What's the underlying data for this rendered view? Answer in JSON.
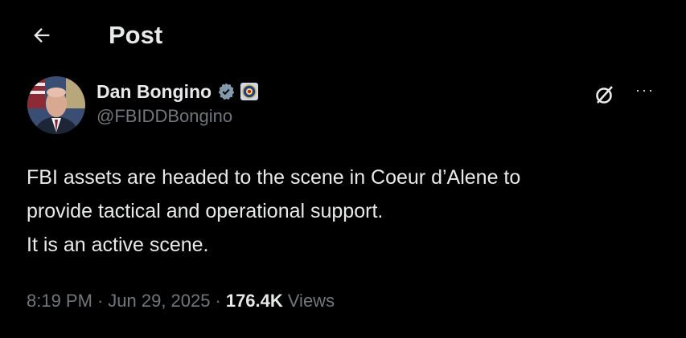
{
  "header": {
    "back_icon": "arrow-left-icon",
    "title": "Post"
  },
  "author": {
    "display_name": "Dan Bongino",
    "handle": "@FBIDDBongino",
    "verified_icon": "verified-badge-icon",
    "affiliation_icon": "fbi-seal-icon",
    "verified_color": "#829aab"
  },
  "actions": {
    "grok_icon": "grok-icon",
    "more_label": "···"
  },
  "tweet": {
    "lines": [
      "FBI assets are headed to the scene in Coeur d’Alene to",
      "provide tactical and operational support.",
      "It is an active scene."
    ]
  },
  "meta": {
    "time": "8:19 PM",
    "sep1": "·",
    "date": "Jun 29, 2025",
    "sep2": "·",
    "views_count": "176.4K",
    "views_label": "Views"
  },
  "colors": {
    "background": "#000000",
    "text_primary": "#e7e9ea",
    "text_secondary": "#71767b"
  }
}
